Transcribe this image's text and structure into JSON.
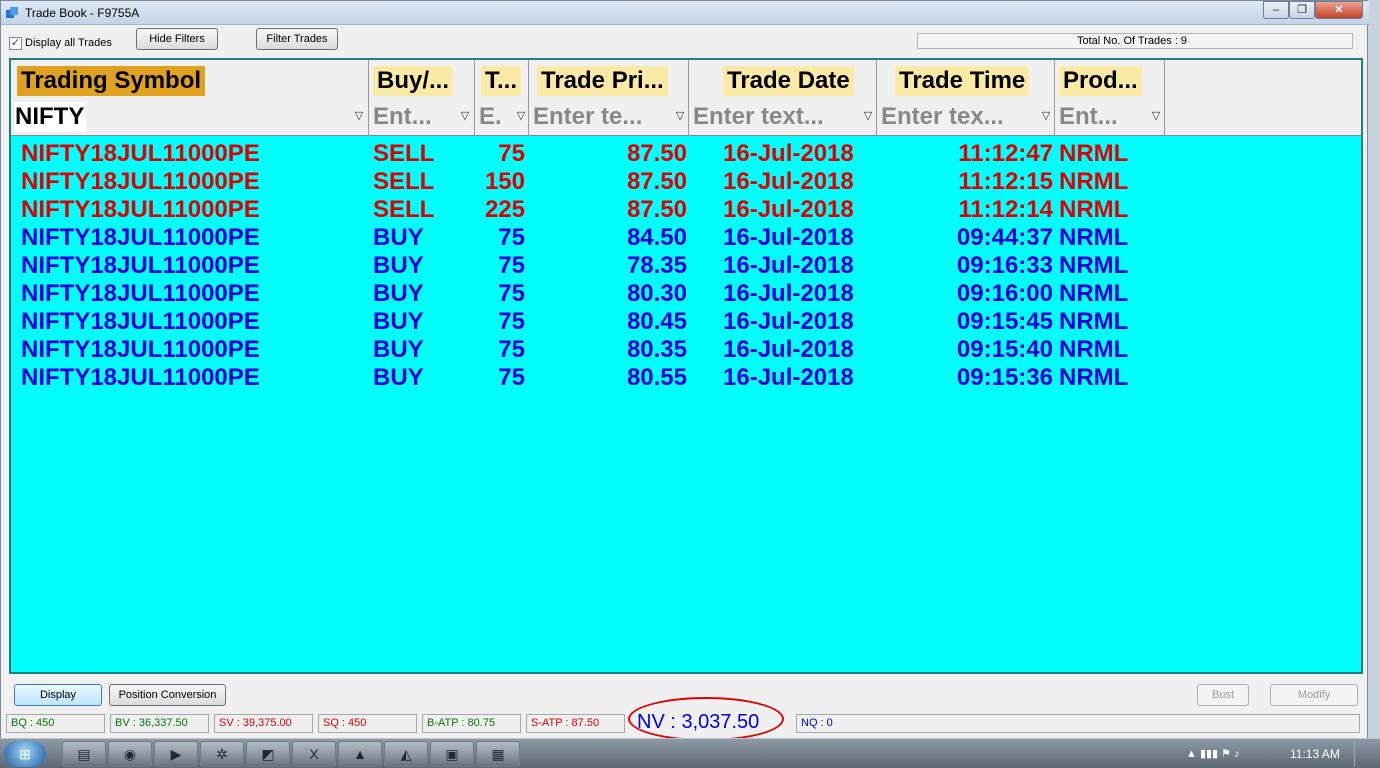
{
  "window": {
    "title": "Trade Book - F9755A",
    "minimize_glyph": "‒",
    "maximize_glyph": "❐",
    "close_glyph": "✕"
  },
  "toolbar": {
    "display_all_label": "Display all Trades",
    "display_all_checked": "✓",
    "hide_filters_label": "Hide Filters",
    "filter_trades_label": "Filter Trades",
    "total_trades_text": "Total No. Of Trades : 9"
  },
  "columns": {
    "symbol": "Trading Symbol",
    "side": "Buy/...",
    "qty": "T...",
    "price": "Trade Pri...",
    "date": "Trade Date",
    "time": "Trade Time",
    "product": "Prod..."
  },
  "filters": {
    "symbol_value": "NIFTY",
    "side_placeholder": "Ent...",
    "qty_placeholder": "E.",
    "price_placeholder": "Enter te...",
    "date_placeholder": "Enter text...",
    "time_placeholder": "Enter tex...",
    "product_placeholder": "Ent...",
    "icon_glyph": "▽"
  },
  "colors": {
    "grid_background": "#00ffff",
    "sell_row": "#e00000",
    "buy_row": "#0000e0",
    "header_gold": "#e0a020",
    "header_pale": "#fbe9a6"
  },
  "trades": [
    {
      "symbol": "NIFTY18JUL11000PE",
      "side": "SELL",
      "qty": "75",
      "price": "87.50",
      "date": "16-Jul-2018",
      "time": "11:12:47",
      "product": "NRML"
    },
    {
      "symbol": "NIFTY18JUL11000PE",
      "side": "SELL",
      "qty": "150",
      "price": "87.50",
      "date": "16-Jul-2018",
      "time": "11:12:15",
      "product": "NRML"
    },
    {
      "symbol": "NIFTY18JUL11000PE",
      "side": "SELL",
      "qty": "225",
      "price": "87.50",
      "date": "16-Jul-2018",
      "time": "11:12:14",
      "product": "NRML"
    },
    {
      "symbol": "NIFTY18JUL11000PE",
      "side": "BUY",
      "qty": "75",
      "price": "84.50",
      "date": "16-Jul-2018",
      "time": "09:44:37",
      "product": "NRML"
    },
    {
      "symbol": "NIFTY18JUL11000PE",
      "side": "BUY",
      "qty": "75",
      "price": "78.35",
      "date": "16-Jul-2018",
      "time": "09:16:33",
      "product": "NRML"
    },
    {
      "symbol": "NIFTY18JUL11000PE",
      "side": "BUY",
      "qty": "75",
      "price": "80.30",
      "date": "16-Jul-2018",
      "time": "09:16:00",
      "product": "NRML"
    },
    {
      "symbol": "NIFTY18JUL11000PE",
      "side": "BUY",
      "qty": "75",
      "price": "80.45",
      "date": "16-Jul-2018",
      "time": "09:15:45",
      "product": "NRML"
    },
    {
      "symbol": "NIFTY18JUL11000PE",
      "side": "BUY",
      "qty": "75",
      "price": "80.35",
      "date": "16-Jul-2018",
      "time": "09:15:40",
      "product": "NRML"
    },
    {
      "symbol": "NIFTY18JUL11000PE",
      "side": "BUY",
      "qty": "75",
      "price": "80.55",
      "date": "16-Jul-2018",
      "time": "09:15:36",
      "product": "NRML"
    }
  ],
  "buttons": {
    "display": "Display",
    "position_conversion": "Position Conversion",
    "bust": "Bust",
    "modify": "Modify"
  },
  "status": {
    "bq": "BQ : 450",
    "bv": "BV : 36,337.50",
    "sv": "SV : 39,375.00",
    "sq": "SQ : 450",
    "batp": "B-ATP : 80.75",
    "satp": "S-ATP : 87.50",
    "nv": "NV : 3,037.50",
    "nq": "NQ : 0"
  },
  "taskbar": {
    "start_glyph": "⊞",
    "items": [
      {
        "name": "explorer",
        "glyph": "▤"
      },
      {
        "name": "chrome",
        "glyph": "◉"
      },
      {
        "name": "media-player",
        "glyph": "▶"
      },
      {
        "name": "app-4",
        "glyph": "✲"
      },
      {
        "name": "app-5",
        "glyph": "◩"
      },
      {
        "name": "excel",
        "glyph": "X"
      },
      {
        "name": "app-7",
        "glyph": "▲"
      },
      {
        "name": "app-8",
        "glyph": "◭"
      },
      {
        "name": "app-9",
        "glyph": "▣"
      },
      {
        "name": "calculator",
        "glyph": "▦"
      }
    ],
    "tray": "▲  ▮▮▮  ⚑  ♪",
    "clock": "11:13 AM"
  }
}
